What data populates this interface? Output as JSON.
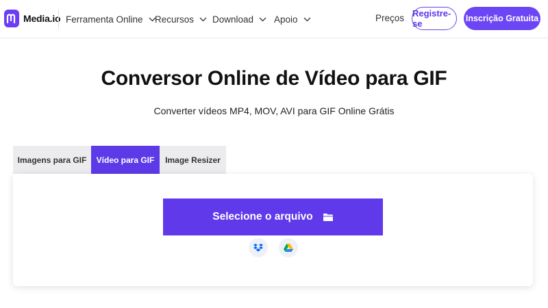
{
  "header": {
    "logo_text": "Media.io",
    "logo_icon": "media-io-logo-icon",
    "nav": [
      {
        "label": "Ferramenta Online",
        "icon": "chevron-down-icon"
      },
      {
        "label": "Recursos",
        "icon": "chevron-down-icon"
      },
      {
        "label": "Download",
        "icon": "chevron-down-icon"
      },
      {
        "label": "Apoio",
        "icon": "chevron-down-icon"
      }
    ],
    "precos": "Preços",
    "registre_label": "Registre-se",
    "inscricao_label": "Inscrição Gratuita"
  },
  "hero": {
    "title": "Conversor Online de Vídeo para GIF",
    "subtitle": "Converter vídeos MP4, MOV, AVI para GIF Online Grátis"
  },
  "tabs": [
    {
      "label": "Imagens para GIF",
      "active": false
    },
    {
      "label": "Vídeo para GIF",
      "active": true
    },
    {
      "label": "Image Resizer",
      "active": false
    }
  ],
  "upload": {
    "select_label": "Selecione o arquivo",
    "select_icon": "folder-icon",
    "sources": [
      "dropbox-icon",
      "google-drive-icon"
    ]
  },
  "colors": {
    "brand": "#6c46f4",
    "primary_button": "#5f39ea",
    "active_tab": "#5d3ae8",
    "inactive_tab": "#ececef"
  }
}
